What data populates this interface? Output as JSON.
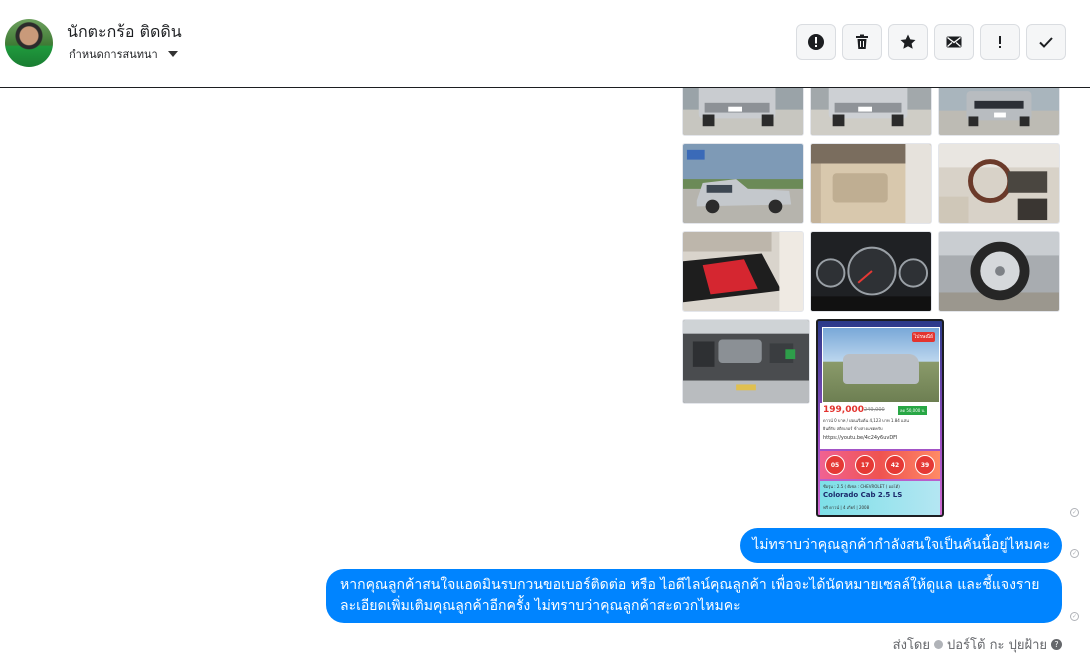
{
  "header": {
    "contact_name": "นักตะกร้อ ติดดิน",
    "assign_label": "กำหนดการสนทนา"
  },
  "toolbar": [
    {
      "name": "alert-button",
      "icon": "exclamation-circle-icon"
    },
    {
      "name": "delete-button",
      "icon": "trash-icon"
    },
    {
      "name": "star-button",
      "icon": "star-icon"
    },
    {
      "name": "mark-unread-button",
      "icon": "envelope-icon"
    },
    {
      "name": "spam-button",
      "icon": "exclamation-icon"
    },
    {
      "name": "done-button",
      "icon": "check-icon"
    }
  ],
  "ad": {
    "tag": "ไปรษณีย์",
    "price": "199,000",
    "old_price": "249,000",
    "green_text": "ลด 50,000 บ.",
    "line1": "ดาวน์ 0 บาท / ผ่อนเริ่มต้น 4,123 บาท 1.84 แสน",
    "line2": "ยินดีรับ สติกเกอร์ ข้างล่างแชตครับ",
    "url": "https://youtu.be/4c24y6uvDFI",
    "checks": [
      "05",
      "17",
      "42",
      "39"
    ],
    "spec": "ชื่อรุ่น : 2.5 ( ดีเซล : CHEVROLET ( ออโต้)",
    "model": "Colorado Cab 2.5 LS",
    "foot": "ฟรี ดาวน์ | 4 เกียร์ | 2008"
  },
  "messages": [
    {
      "text": "ไม่ทราบว่าคุณลูกค้ากำลังสนใจเป็นคันนี้อยู่ไหมคะ"
    },
    {
      "text": "หากคุณลูกค้าสนใจแอดมินรบกวนขอเบอร์ติดต่อ หรือ ไอดีไลน์คุณลูกค้า เพื่อจะได้นัดหมายเซลล์ให้ดูแล และชี้แจงรายละเอียดเพิ่มเติมคุณลูกค้าอีกครั้ง ไม่ทราบว่าคุณลูกค้าสะดวกไหมคะ"
    }
  ],
  "sender": {
    "prefix": "ส่งโดย",
    "name": "ปอร์โต้ กะ ปุยฝ้าย"
  }
}
